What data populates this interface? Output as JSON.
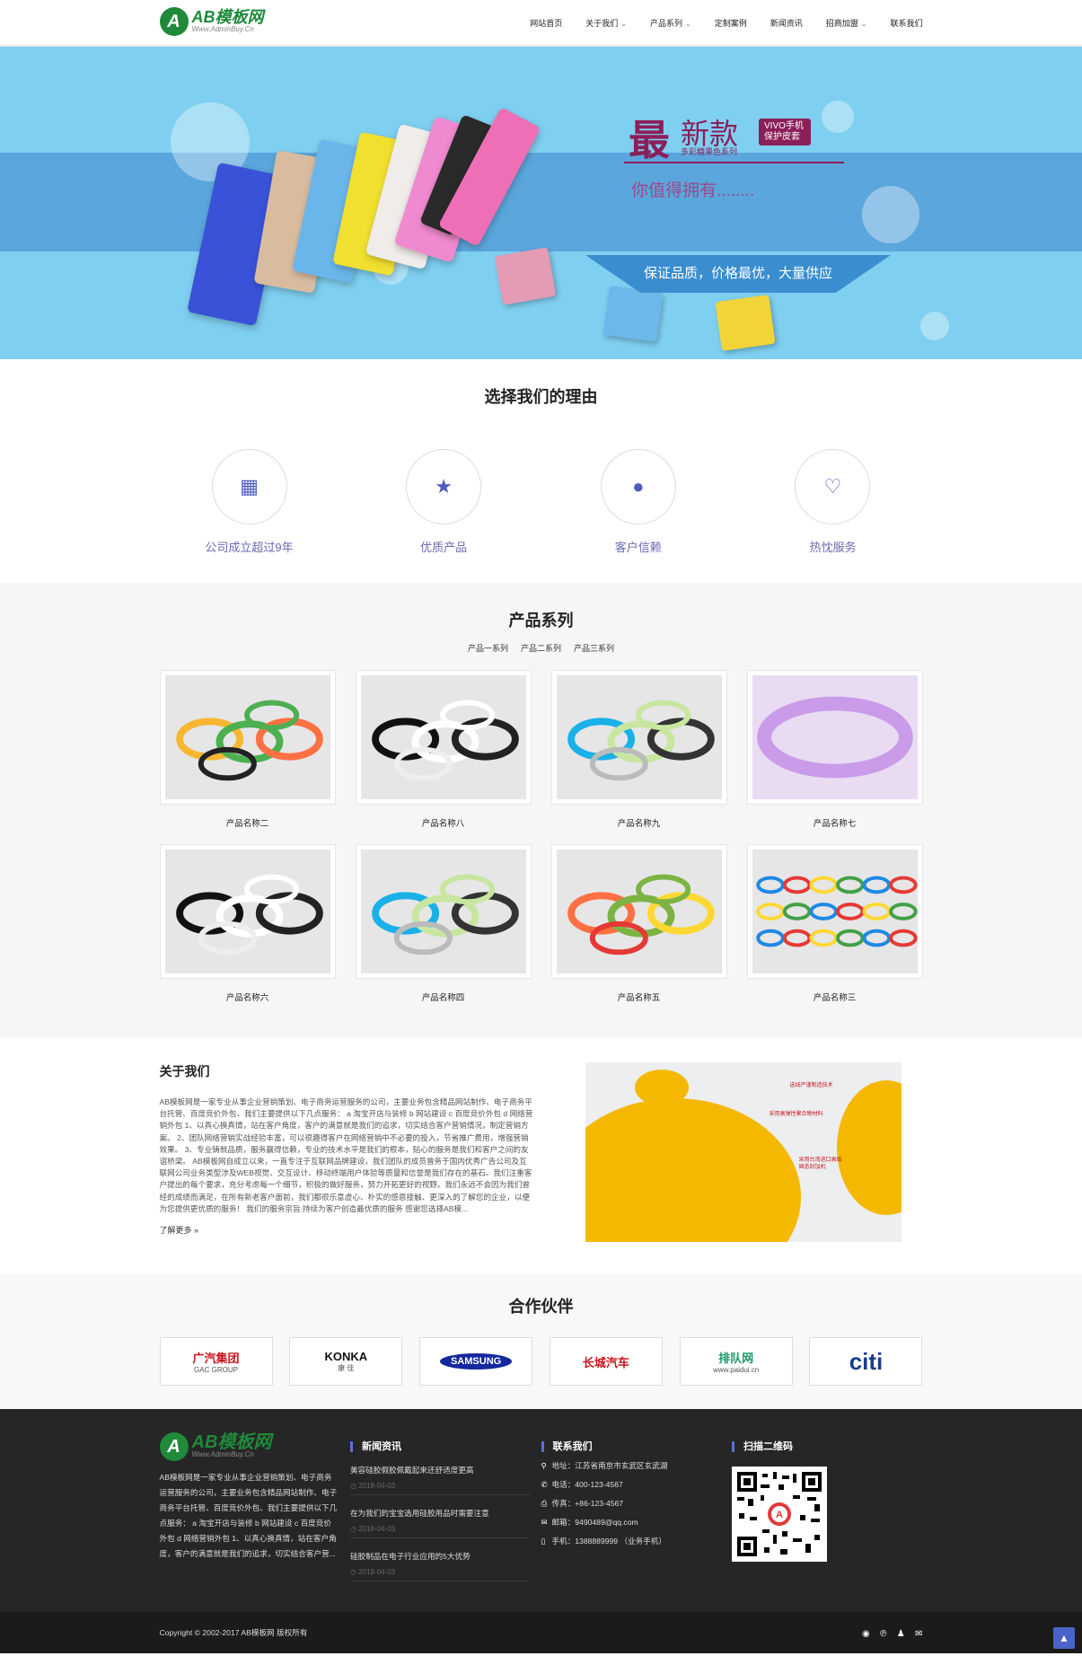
{
  "header": {
    "logo_text": "AB模板网",
    "logo_url": "Www.AdminBuy.Cn",
    "nav": [
      {
        "label": "网站首页",
        "dropdown": false
      },
      {
        "label": "关于我们",
        "dropdown": true
      },
      {
        "label": "产品系列",
        "dropdown": true
      },
      {
        "label": "定制案例",
        "dropdown": false
      },
      {
        "label": "新闻资讯",
        "dropdown": false
      },
      {
        "label": "招商加盟",
        "dropdown": true
      },
      {
        "label": "联系我们",
        "dropdown": false
      }
    ]
  },
  "banner": {
    "big": "最",
    "new": "新款",
    "tag": "VIVO手机保护皮套",
    "sub": "多彩糖果色系列",
    "value": "你值得拥有........",
    "slogan": "保证品质，价格最优，大量供应"
  },
  "reasons": {
    "title": "选择我们的理由",
    "items": [
      {
        "label": "公司成立超过9年",
        "icon": "calendar-icon",
        "glyph": "▦"
      },
      {
        "label": "优质产品",
        "icon": "star-icon",
        "glyph": "★"
      },
      {
        "label": "客户信赖",
        "icon": "drop-icon",
        "glyph": "●"
      },
      {
        "label": "热忱服务",
        "icon": "heart-icon",
        "glyph": "♡"
      }
    ]
  },
  "products": {
    "title": "产品系列",
    "tabs": [
      "产品一系列",
      "产品二系列",
      "产品三系列"
    ],
    "items": [
      {
        "name": "产品名称二"
      },
      {
        "name": "产品名称八"
      },
      {
        "name": "产品名称九"
      },
      {
        "name": "产品名称七"
      },
      {
        "name": "产品名称六"
      },
      {
        "name": "产品名称四"
      },
      {
        "name": "产品名称五"
      },
      {
        "name": "产品名称三"
      }
    ]
  },
  "about": {
    "title": "关于我们",
    "text": "AB模板网是一家专业从事企业营销策划、电子商务运营服务的公司，主要业务包含精品网站制作、电子商务平台托管、百度竞价外包、我们主要提供以下几点服务： a 淘宝开店与装修 b 网站建设 c 百度竞价外包 d 网络营销外包 1、以真心换真情，站在客户角度，客户的满意就是我们的追求，切实结合客户营销情况，制定营销方案。 2、团队网络营销实战经验丰富，可以很趣得客户在网络营销中不必要的投入，节省推广费用，增强营销效果。 3、专业铸就品质，服务赢得信赖，专业的技术水平是我们的根本，贴心的服务是我们和客户之间的友谊桥梁。 AB模板网自成立以来，一直专注于互联网品牌建设，我们团队的成员曾务于国内优秀广告公司及互联网公司业务类型涉及WEB视觉、交互设计、移动终端用户体验等质量和信誉是我们存在的基石。我们注重客户提出的每个要求，充分考虑每一个细节，积极的做好服务，努力开拓更好的视野。我们永远不会因为我们曾经的成绩而满足，在所有新老客户面前，我们都很乐意虚心、朴实的感恩接触、更深入的了解您的企业，以便为您提供更优质的服务！ 我们的服务宗旨:持续为客户创造最优质的服务 感谢您选择AB模...",
    "more": "了解更多 »",
    "img_labels": [
      "选线严谨制造技术",
      "采用高弹性聚合物材料",
      "采用台湾进口高级固态封加机"
    ]
  },
  "partners": {
    "title": "合作伙伴",
    "logos": [
      {
        "name": "广汽集团",
        "sub": "GAC GROUP",
        "color": "#c8161d"
      },
      {
        "name": "KONKA",
        "sub": "康 佳",
        "color": "#111111"
      },
      {
        "name": "SAMSUNG",
        "sub": "",
        "color": "#1428a0"
      },
      {
        "name": "长城汽车",
        "sub": "",
        "color": "#c8161d"
      },
      {
        "name": "排队网",
        "sub": "www.paidui.cn",
        "color": "#1a9a6a"
      },
      {
        "name": "citi",
        "sub": "",
        "color": "#1a3c8c"
      }
    ]
  },
  "footer": {
    "logo_text": "AB模板网",
    "logo_url": "Www.AdminBuy.Cn",
    "about": "AB模板网是一家专业从事企业营销策划、电子商务运营服务的公司，主要业务包含精品网站制作、电子商务平台托管、百度竞价外包、我们主要提供以下几点服务： a 淘宝开店与装修 b 网站建设 c 百度竞价外包 d 网络营销外包 1、以真心换真情，站在客户角度，客户的满意就是我们的追求，切实结合客户营...",
    "news_title": "新闻资讯",
    "news": [
      {
        "title": "美容硅胶假胶佩戴起来还舒适度更高",
        "date": "2018-04-03"
      },
      {
        "title": "在为我们的宝宝选用硅胶用品时需要注意",
        "date": "2018-04-03"
      },
      {
        "title": "硅胶制品在电子行业应用的5大优势",
        "date": "2018-04-03"
      }
    ],
    "contact_title": "联系我们",
    "contact": [
      {
        "icon": "location-icon",
        "glyph": "⚲",
        "text": "地址：江苏省南京市玄武区玄武湖"
      },
      {
        "icon": "phone-icon",
        "glyph": "✆",
        "text": "电话：400-123-4567"
      },
      {
        "icon": "fax-icon",
        "glyph": "⎙",
        "text": "传真：+86-123-4567"
      },
      {
        "icon": "mail-icon",
        "glyph": "✉",
        "text": "邮箱：9490489@qq.com"
      },
      {
        "icon": "mobile-icon",
        "glyph": "▯",
        "text": "手机：1388889999 （业务手机）"
      }
    ],
    "qr_title": "扫描二维码",
    "copyright": "Copyright © 2002-2017 AB模板网 版权所有"
  },
  "colors": {
    "accent": "#4f5bbd",
    "brand_green": "#1e8a3a",
    "banner_bg": "#7fcff0",
    "footer_bg": "#262626"
  }
}
